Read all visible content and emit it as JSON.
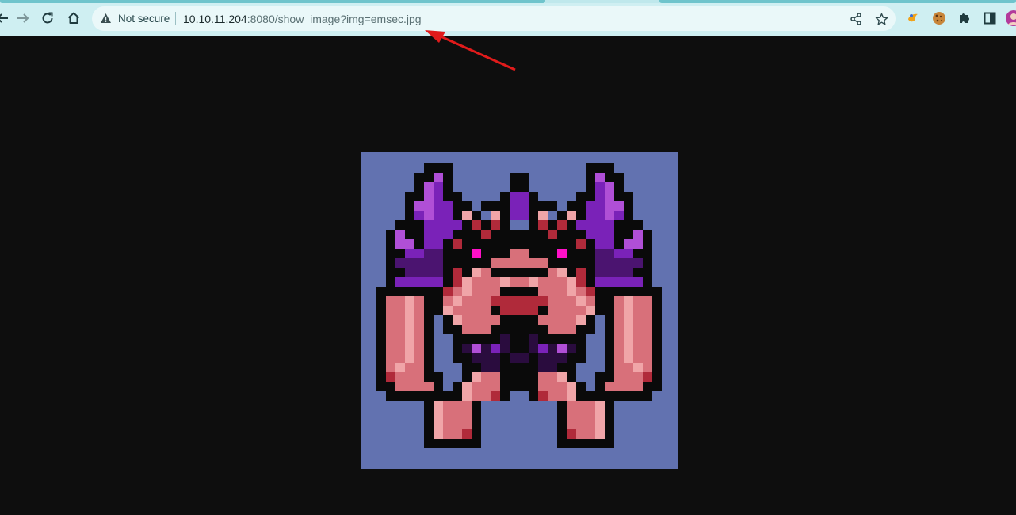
{
  "browser": {
    "security_label": "Not secure",
    "url_host": "10.10.11.204",
    "url_rest": ":8080/show_image?img=emsec.jpg",
    "icons": {
      "back": "back-arrow-icon",
      "forward": "forward-arrow-icon",
      "reload": "reload-icon",
      "home": "home-icon",
      "warning": "warning-triangle-icon",
      "share": "share-icon",
      "bookmark": "star-icon",
      "extensions": [
        "extension-icon-orange",
        "cookie-icon",
        "puzzle-icon",
        "side-panel-icon",
        "profile-avatar"
      ]
    },
    "colors": {
      "toolbar": "#cfeff2",
      "omnibox": "#eaf8f9"
    }
  },
  "page": {
    "background": "#0e0e0e",
    "image": {
      "name": "emsec.jpg",
      "background": "#6272b0"
    }
  },
  "annotation": {
    "type": "red-arrow",
    "color": "#e01b1b"
  }
}
